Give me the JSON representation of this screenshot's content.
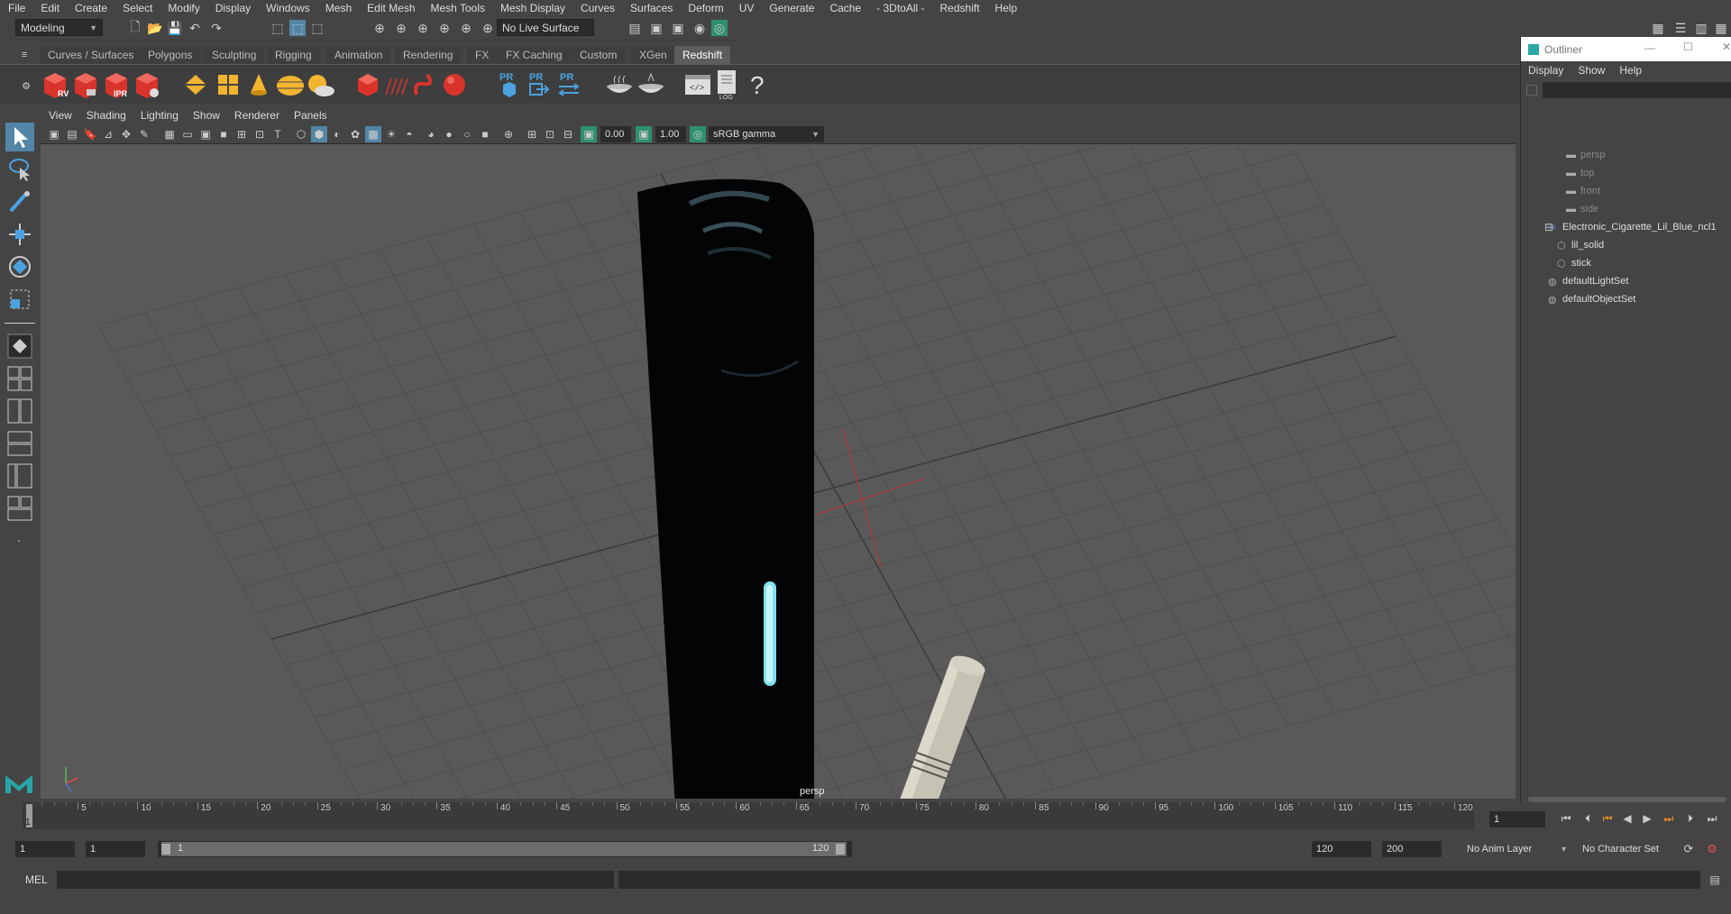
{
  "menubar": [
    "File",
    "Edit",
    "Create",
    "Select",
    "Modify",
    "Display",
    "Windows",
    "Mesh",
    "Edit Mesh",
    "Mesh Tools",
    "Mesh Display",
    "Curves",
    "Surfaces",
    "Deform",
    "UV",
    "Generate",
    "Cache",
    "- 3DtoAll -",
    "Redshift",
    "Help"
  ],
  "status": {
    "mode": "Modeling",
    "live_surface": "No Live Surface"
  },
  "shelf_tabs": [
    "Curves / Surfaces",
    "Polygons",
    "Sculpting",
    "Rigging",
    "Animation",
    "Rendering",
    "FX",
    "FX Caching",
    "Custom",
    "XGen",
    "Redshift"
  ],
  "shelf_active": "Redshift",
  "shelf_labels": {
    "rv": "RV",
    "ipr": "IPR",
    "pr": "PR",
    "log": "LOG",
    "help": "?"
  },
  "viewport": {
    "menu": [
      "View",
      "Shading",
      "Lighting",
      "Show",
      "Renderer",
      "Panels"
    ],
    "exposure": "0.00",
    "gamma": "1.00",
    "color_space": "sRGB gamma",
    "camera_label": "persp"
  },
  "outliner": {
    "title": "Outliner",
    "menu": [
      "Display",
      "Show",
      "Help"
    ],
    "items": [
      {
        "label": "persp",
        "icon": "camera-icon",
        "dim": true
      },
      {
        "label": "top",
        "icon": "camera-icon",
        "dim": true
      },
      {
        "label": "front",
        "icon": "camera-icon",
        "dim": true
      },
      {
        "label": "side",
        "icon": "camera-icon",
        "dim": true
      },
      {
        "label": "Electronic_Cigarette_Lil_Blue_ncl1",
        "icon": "group-icon",
        "dim": false
      },
      {
        "label": "lil_solid",
        "icon": "mesh-icon",
        "dim": false
      },
      {
        "label": "stick",
        "icon": "mesh-icon",
        "dim": false
      },
      {
        "label": "defaultLightSet",
        "icon": "set-icon",
        "dim": false
      },
      {
        "label": "defaultObjectSet",
        "icon": "set-icon",
        "dim": false
      }
    ]
  },
  "timeline": {
    "ticks": [
      "5",
      "10",
      "15",
      "20",
      "25",
      "30",
      "35",
      "40",
      "45",
      "50",
      "55",
      "60",
      "65",
      "70",
      "75",
      "80",
      "85",
      "90",
      "95",
      "100",
      "105",
      "110",
      "115",
      "120"
    ],
    "current_frame_marker": "1",
    "current_frame": "1"
  },
  "range": {
    "start": "1",
    "inner_start": "1",
    "slider_start": "1",
    "slider_end": "120",
    "end": "120",
    "outer_end": "200",
    "anim_layer": "No Anim Layer",
    "character_set": "No Character Set"
  },
  "cmdline": {
    "label": "MEL"
  }
}
